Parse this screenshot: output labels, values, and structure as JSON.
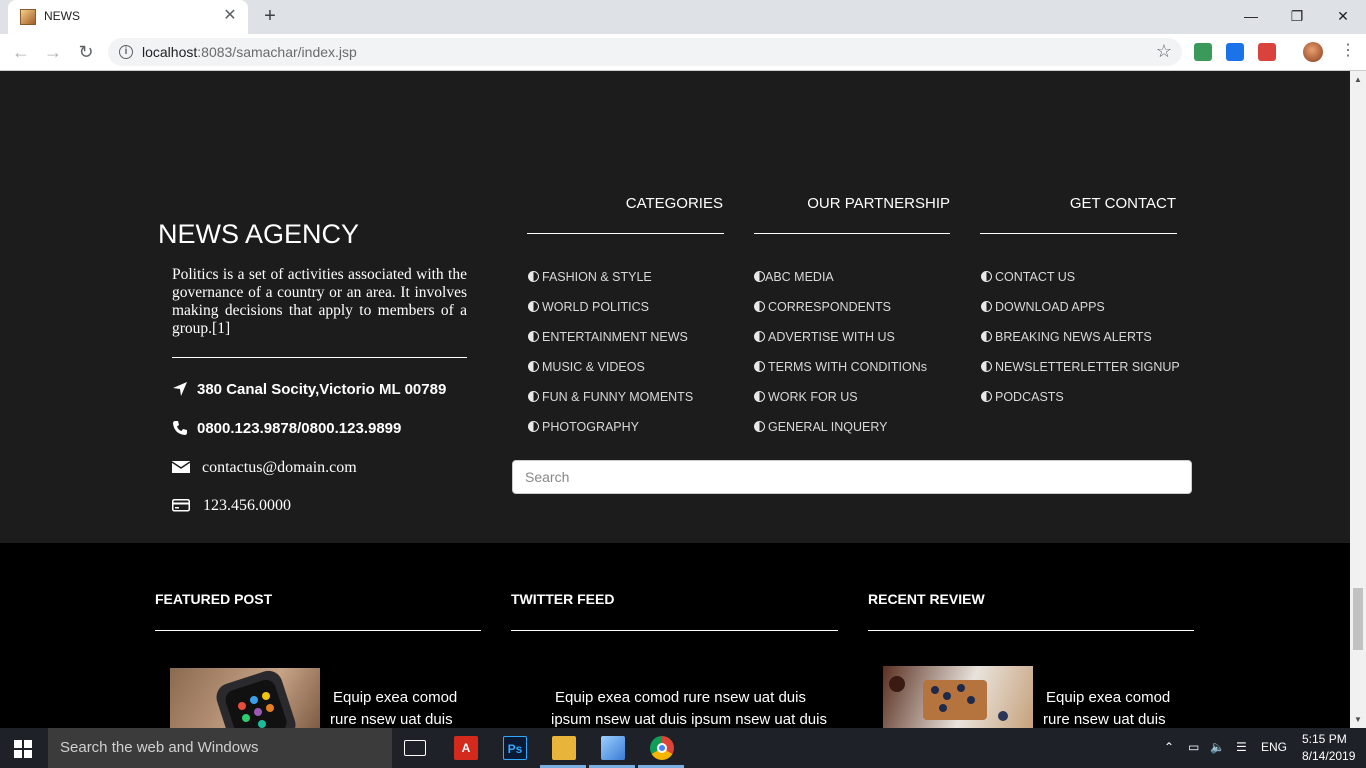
{
  "browser": {
    "tab_title": "NEWS",
    "url_host": "localhost",
    "url_rest": ":8083/samachar/index.jsp"
  },
  "agency": {
    "title": "NEWS AGENCY",
    "description": "Politics is a set of activities associated with the governance of a country or an area. It involves making decisions that apply to members of a group.[1]",
    "address": "380 Canal Socity,Victorio ML 00789",
    "phone": "0800.123.9878/0800.123.9899",
    "email": "contactus@domain.com",
    "fax": "123.456.0000"
  },
  "columns": {
    "categories": {
      "heading": "CATEGORIES",
      "links": [
        "FASHION & STYLE",
        "WORLD POLITICS",
        "ENTERTAINMENT NEWS",
        "MUSIC & VIDEOS",
        "FUN & FUNNY MOMENTS",
        "PHOTOGRAPHY"
      ]
    },
    "partnership": {
      "heading": "OUR PARTNERSHIP",
      "links": [
        "ABC MEDIA",
        "CORRESPONDENTS",
        "ADVERTISE WITH US",
        "TERMS WITH CONDITIONs",
        "WORK FOR US",
        "GENERAL INQUERY"
      ]
    },
    "contact": {
      "heading": "GET CONTACT",
      "links": [
        "CONTACT US",
        "DOWNLOAD APPS",
        "BREAKING NEWS ALERTS",
        "NEWSLETTERLETTER SIGNUP",
        "PODCASTS"
      ]
    }
  },
  "search": {
    "placeholder": "Search"
  },
  "sections": {
    "featured": {
      "heading": "FEATURED POST",
      "line1": "Equip exea comod",
      "line2": "rure  nsew uat duis"
    },
    "twitter": {
      "heading": "TWITTER FEED",
      "line1": "Equip exea comod rure  nsew uat duis",
      "line2": "ipsum nsew uat duis ipsum nsew uat duis"
    },
    "review": {
      "heading": "RECENT REVIEW",
      "line1": "Equip exea comod",
      "line2": "rure  nsew uat duis"
    }
  },
  "taskbar": {
    "search_placeholder": "Search the web and Windows",
    "language": "ENG",
    "time": "5:15 PM",
    "date": "8/14/2019"
  },
  "icons": {
    "address": "location-arrow-icon",
    "phone": "phone-icon",
    "email": "envelope-icon",
    "fax": "credit-card-icon",
    "bullet": "half-circle-icon"
  }
}
